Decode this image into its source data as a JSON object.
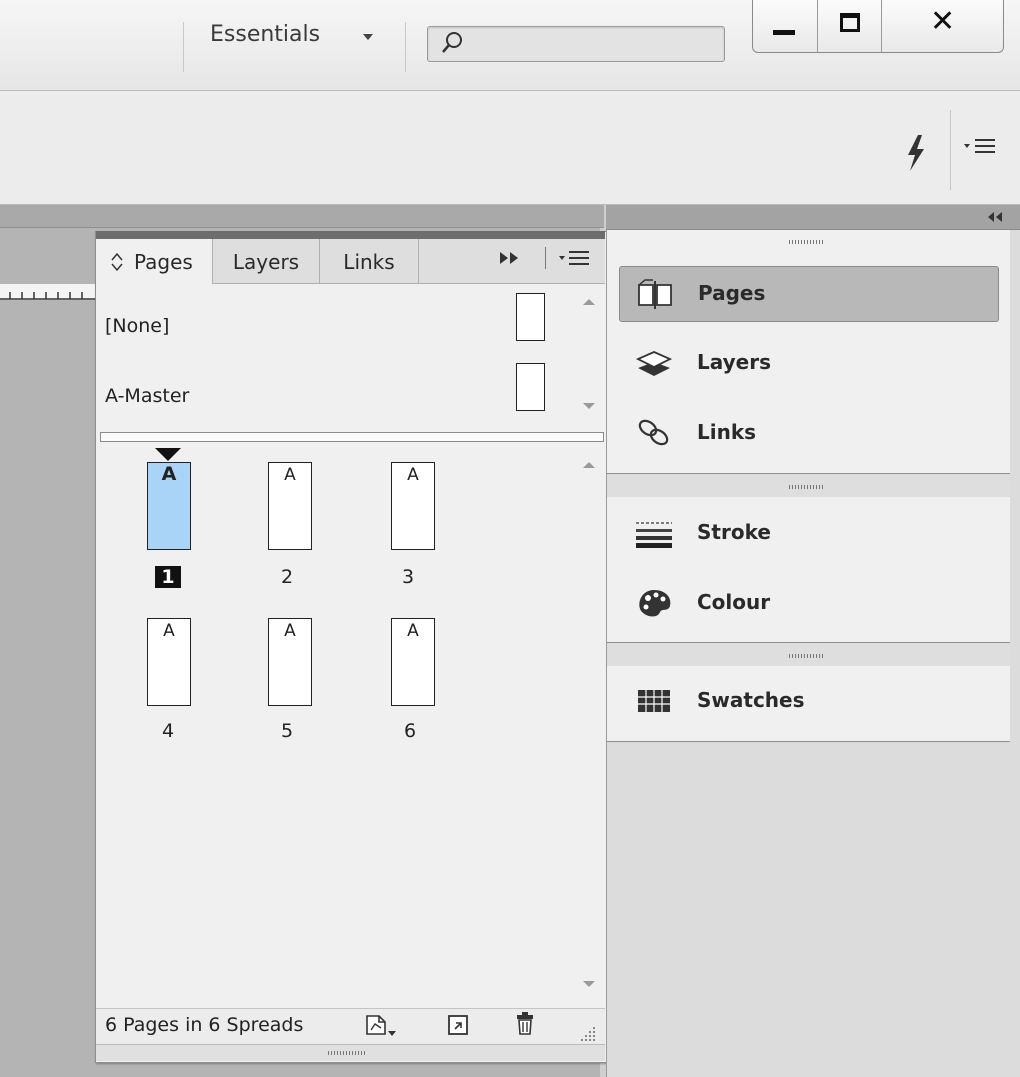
{
  "titlebar": {
    "workspace": "Essentials",
    "search": {
      "value": "",
      "placeholder": ""
    }
  },
  "pages_panel": {
    "tabs": [
      {
        "label": "Pages"
      },
      {
        "label": "Layers"
      },
      {
        "label": "Links"
      }
    ],
    "masters": [
      {
        "label": "[None]"
      },
      {
        "label": "A-Master"
      }
    ],
    "pages": [
      {
        "number": "1",
        "master": "A",
        "selected": true
      },
      {
        "number": "2",
        "master": "A"
      },
      {
        "number": "3",
        "master": "A"
      },
      {
        "number": "4",
        "master": "A"
      },
      {
        "number": "5",
        "master": "A"
      },
      {
        "number": "6",
        "master": "A"
      }
    ],
    "status": "6 Pages in 6 Spreads"
  },
  "dock": {
    "group1": [
      {
        "label": "Pages",
        "active": true
      },
      {
        "label": "Layers"
      },
      {
        "label": "Links"
      }
    ],
    "group2": [
      {
        "label": "Stroke"
      },
      {
        "label": "Colour"
      }
    ],
    "group3": [
      {
        "label": "Swatches"
      }
    ]
  },
  "colors": {
    "selected_page": "#a9d3f7",
    "active_dock_item": "#b8b8b8"
  },
  "icons": [
    "search-icon",
    "minimize-icon",
    "maximize-icon",
    "close-icon",
    "lightning-bolt-icon",
    "panel-menu-icon",
    "tab-cycle-icon",
    "collapse-arrows-icon",
    "scroll-up-icon",
    "scroll-down-icon",
    "new-page-icon",
    "create-page-icon",
    "trash-icon",
    "resize-grip-icon",
    "pages-icon",
    "layers-icon",
    "links-icon",
    "stroke-icon",
    "colour-icon",
    "swatches-icon"
  ]
}
